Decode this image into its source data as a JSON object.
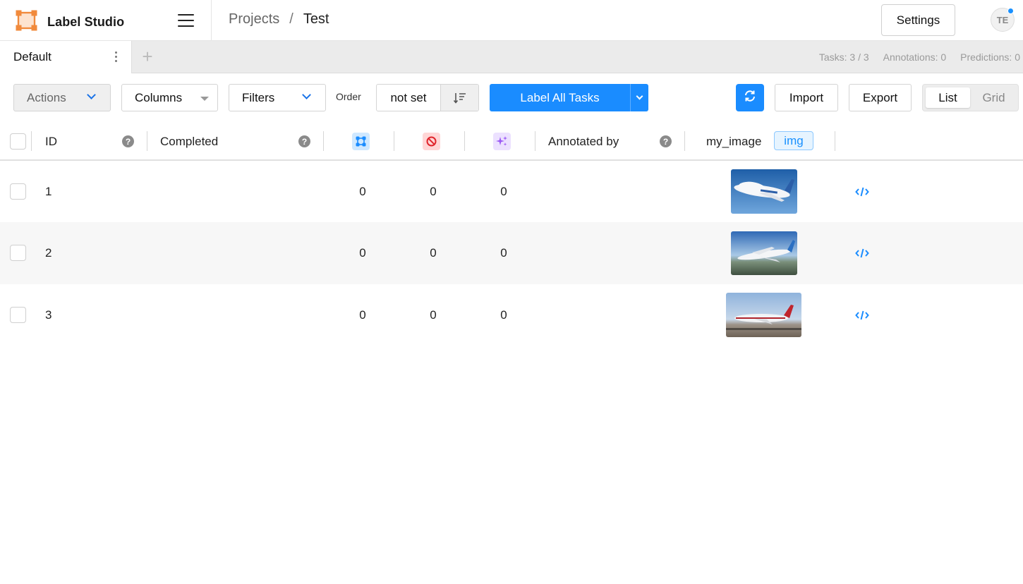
{
  "app": {
    "title": "Label Studio"
  },
  "breadcrumb": {
    "projects": "Projects",
    "separator": "/",
    "current": "Test"
  },
  "header": {
    "settings_label": "Settings",
    "avatar_initials": "TE"
  },
  "tabs": [
    {
      "label": "Default",
      "active": true
    }
  ],
  "stats": {
    "tasks": "Tasks: 3 / 3",
    "annotations": "Annotations: 0",
    "predictions": "Predictions: 0"
  },
  "toolbar": {
    "actions_label": "Actions",
    "columns_label": "Columns",
    "filters_label": "Filters",
    "order_label": "Order",
    "order_value": "not set",
    "label_all_label": "Label All Tasks",
    "import_label": "Import",
    "export_label": "Export",
    "view_list_label": "List",
    "view_grid_label": "Grid",
    "active_view": "List"
  },
  "table": {
    "columns": {
      "id": "ID",
      "completed": "Completed",
      "total_annotations_icon": "annotations-icon",
      "cancelled_annotations_icon": "cancelled-icon",
      "predictions_icon": "predictions-icon",
      "annotated_by": "Annotated by",
      "my_image": "my_image",
      "my_image_type": "img"
    },
    "rows": [
      {
        "id": "1",
        "annotations": "0",
        "cancelled": "0",
        "predictions": "0",
        "image": "airplane-thumbnail"
      },
      {
        "id": "2",
        "annotations": "0",
        "cancelled": "0",
        "predictions": "0",
        "image": "airplane-thumbnail"
      },
      {
        "id": "3",
        "annotations": "0",
        "cancelled": "0",
        "predictions": "0",
        "image": "airplane-thumbnail"
      }
    ]
  },
  "colors": {
    "accent": "#1a8cff",
    "logo": "#f18a3c",
    "annotations_icon_bg": "#cfe8ff",
    "cancelled_icon_bg": "#ffd6d6",
    "predictions_icon_bg": "#ece1ff"
  }
}
